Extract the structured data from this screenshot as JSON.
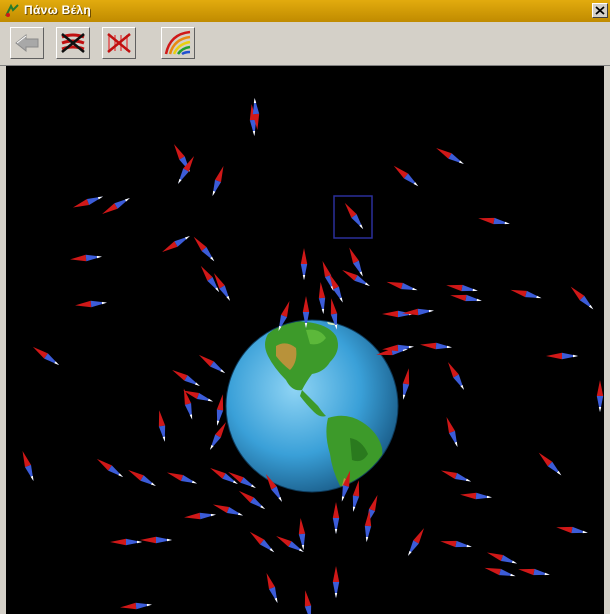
{
  "window": {
    "title": "Πάνω Βέλη"
  },
  "toolbar": {
    "buttons": [
      {
        "id": "back",
        "icon": "back-arrow-icon",
        "enabled": false
      },
      {
        "id": "clear-red",
        "icon": "crossed-field-red-icon",
        "enabled": true
      },
      {
        "id": "clear-lines",
        "icon": "crossed-field-lines-icon",
        "enabled": true
      },
      {
        "id": "field-lines",
        "icon": "rainbow-field-icon",
        "enabled": true
      }
    ]
  },
  "scene": {
    "background": "#000000",
    "earth": {
      "ocean_color": "#3aa0d8",
      "land_color": "#3d9a2a",
      "desert_color": "#b8923a"
    },
    "compass_colors": {
      "north": "#d01818",
      "south": "#3c5cd8",
      "tip": "#ffffff"
    },
    "selection_box_color": "#2a2f9a"
  }
}
